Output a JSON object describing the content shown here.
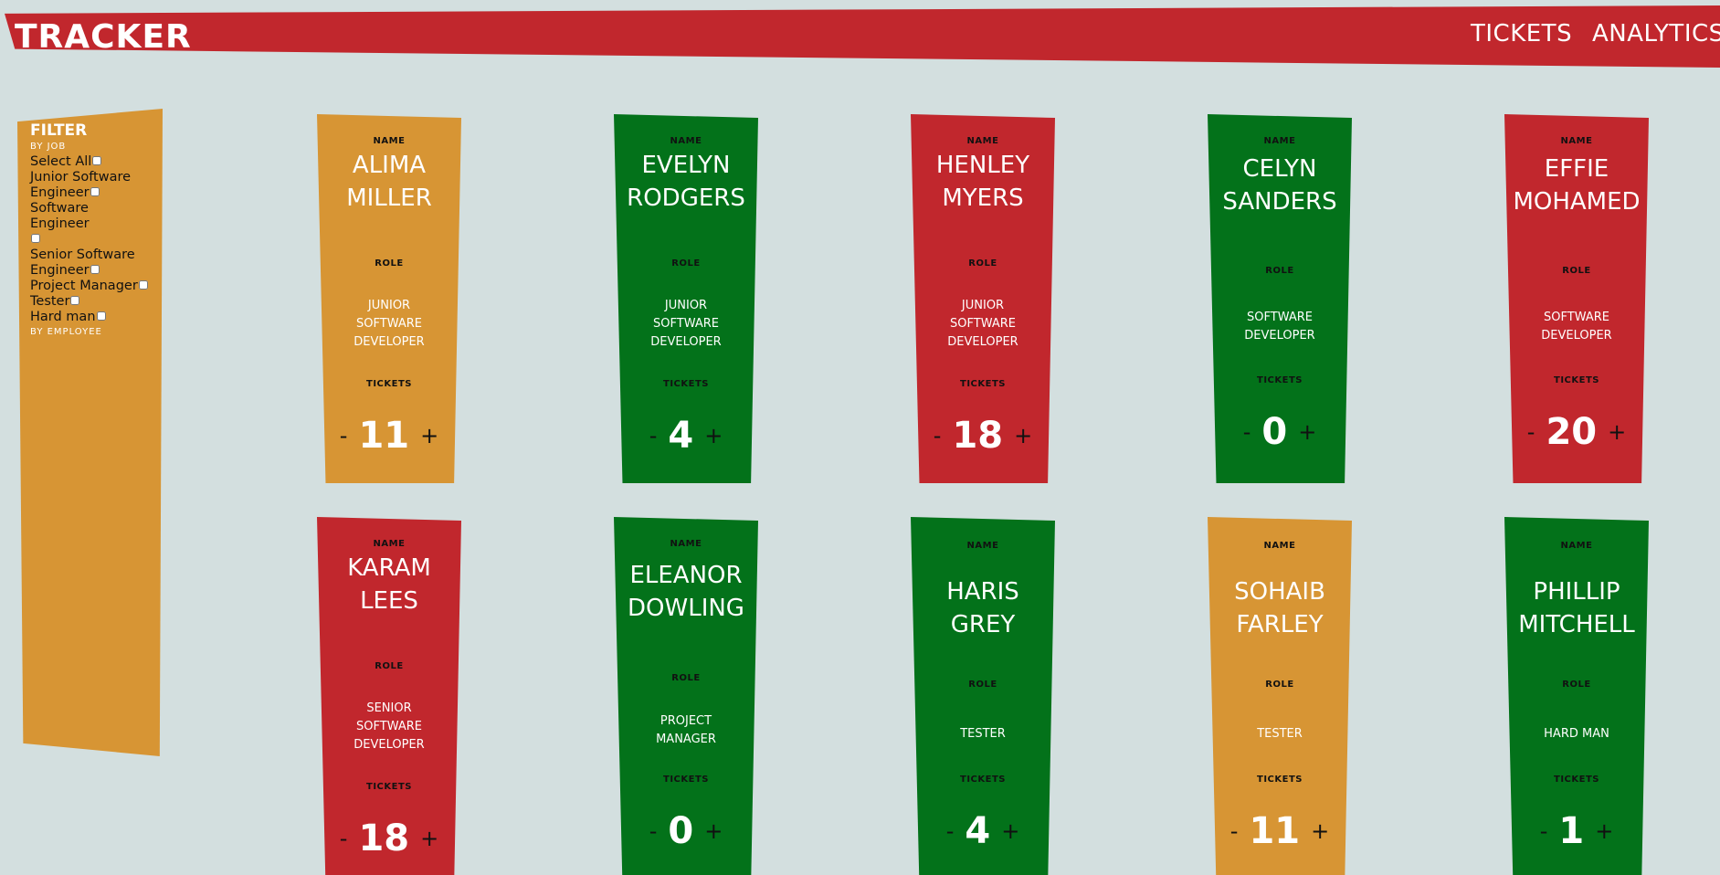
{
  "header": {
    "brand": "TRACKER",
    "nav": [
      "TICKETS",
      "ANALYTICS"
    ]
  },
  "filter": {
    "title": "FILTER",
    "by_job": "BY JOB",
    "options": [
      "Select All",
      "Junior Software Engineer",
      "Software Engineer",
      "Senior Software Engineer",
      "Project Manager",
      "Tester",
      "Hard man"
    ],
    "by_employee": "BY EMPLOYEE"
  },
  "labels": {
    "name": "NAME",
    "role": "ROLE",
    "tickets": "TICKETS",
    "minus": "-",
    "plus": "+"
  },
  "colors": {
    "red": "#c1272d",
    "green": "#03721a",
    "orange": "#d79534",
    "background": "#d3dfdf"
  },
  "employees": [
    {
      "name": "ALIMA MILLER",
      "role": "JUNIOR SOFTWARE DEVELOPER",
      "tickets": "11",
      "color": "orange"
    },
    {
      "name": "EVELYN RODGERS",
      "role": "JUNIOR SOFTWARE DEVELOPER",
      "tickets": "4",
      "color": "green"
    },
    {
      "name": "HENLEY MYERS",
      "role": "JUNIOR SOFTWARE DEVELOPER",
      "tickets": "18",
      "color": "red"
    },
    {
      "name": "CELYN SANDERS",
      "role": "SOFTWARE DEVELOPER",
      "tickets": "0",
      "color": "green"
    },
    {
      "name": "EFFIE MOHAMED",
      "role": "SOFTWARE DEVELOPER",
      "tickets": "20",
      "color": "red"
    },
    {
      "name": "KARAM LEES",
      "role": "SENIOR SOFTWARE DEVELOPER",
      "tickets": "18",
      "color": "red"
    },
    {
      "name": "ELEANOR DOWLING",
      "role": "PROJECT MANAGER",
      "tickets": "0",
      "color": "green"
    },
    {
      "name": "HARIS GREY",
      "role": "TESTER",
      "tickets": "4",
      "color": "green"
    },
    {
      "name": "SOHAIB FARLEY",
      "role": "TESTER",
      "tickets": "11",
      "color": "orange"
    },
    {
      "name": "PHILLIP MITCHELL",
      "role": "HARD MAN",
      "tickets": "1",
      "color": "green"
    }
  ]
}
